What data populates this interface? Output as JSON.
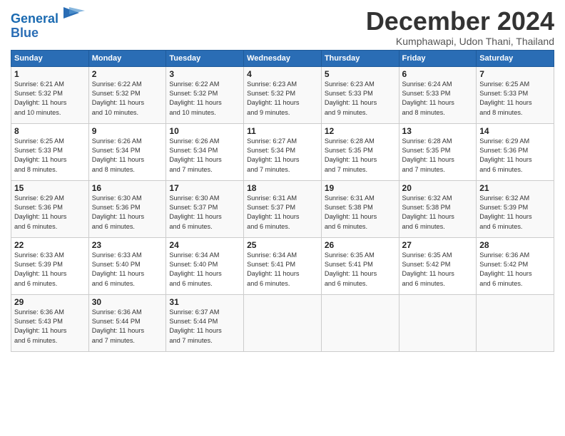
{
  "logo": {
    "line1": "General",
    "line2": "Blue"
  },
  "title": "December 2024",
  "subtitle": "Kumphawapi, Udon Thani, Thailand",
  "headers": [
    "Sunday",
    "Monday",
    "Tuesday",
    "Wednesday",
    "Thursday",
    "Friday",
    "Saturday"
  ],
  "weeks": [
    [
      {
        "day": "1",
        "info": "Sunrise: 6:21 AM\nSunset: 5:32 PM\nDaylight: 11 hours\nand 10 minutes."
      },
      {
        "day": "2",
        "info": "Sunrise: 6:22 AM\nSunset: 5:32 PM\nDaylight: 11 hours\nand 10 minutes."
      },
      {
        "day": "3",
        "info": "Sunrise: 6:22 AM\nSunset: 5:32 PM\nDaylight: 11 hours\nand 10 minutes."
      },
      {
        "day": "4",
        "info": "Sunrise: 6:23 AM\nSunset: 5:32 PM\nDaylight: 11 hours\nand 9 minutes."
      },
      {
        "day": "5",
        "info": "Sunrise: 6:23 AM\nSunset: 5:33 PM\nDaylight: 11 hours\nand 9 minutes."
      },
      {
        "day": "6",
        "info": "Sunrise: 6:24 AM\nSunset: 5:33 PM\nDaylight: 11 hours\nand 8 minutes."
      },
      {
        "day": "7",
        "info": "Sunrise: 6:25 AM\nSunset: 5:33 PM\nDaylight: 11 hours\nand 8 minutes."
      }
    ],
    [
      {
        "day": "8",
        "info": "Sunrise: 6:25 AM\nSunset: 5:33 PM\nDaylight: 11 hours\nand 8 minutes."
      },
      {
        "day": "9",
        "info": "Sunrise: 6:26 AM\nSunset: 5:34 PM\nDaylight: 11 hours\nand 8 minutes."
      },
      {
        "day": "10",
        "info": "Sunrise: 6:26 AM\nSunset: 5:34 PM\nDaylight: 11 hours\nand 7 minutes."
      },
      {
        "day": "11",
        "info": "Sunrise: 6:27 AM\nSunset: 5:34 PM\nDaylight: 11 hours\nand 7 minutes."
      },
      {
        "day": "12",
        "info": "Sunrise: 6:28 AM\nSunset: 5:35 PM\nDaylight: 11 hours\nand 7 minutes."
      },
      {
        "day": "13",
        "info": "Sunrise: 6:28 AM\nSunset: 5:35 PM\nDaylight: 11 hours\nand 7 minutes."
      },
      {
        "day": "14",
        "info": "Sunrise: 6:29 AM\nSunset: 5:36 PM\nDaylight: 11 hours\nand 6 minutes."
      }
    ],
    [
      {
        "day": "15",
        "info": "Sunrise: 6:29 AM\nSunset: 5:36 PM\nDaylight: 11 hours\nand 6 minutes."
      },
      {
        "day": "16",
        "info": "Sunrise: 6:30 AM\nSunset: 5:36 PM\nDaylight: 11 hours\nand 6 minutes."
      },
      {
        "day": "17",
        "info": "Sunrise: 6:30 AM\nSunset: 5:37 PM\nDaylight: 11 hours\nand 6 minutes."
      },
      {
        "day": "18",
        "info": "Sunrise: 6:31 AM\nSunset: 5:37 PM\nDaylight: 11 hours\nand 6 minutes."
      },
      {
        "day": "19",
        "info": "Sunrise: 6:31 AM\nSunset: 5:38 PM\nDaylight: 11 hours\nand 6 minutes."
      },
      {
        "day": "20",
        "info": "Sunrise: 6:32 AM\nSunset: 5:38 PM\nDaylight: 11 hours\nand 6 minutes."
      },
      {
        "day": "21",
        "info": "Sunrise: 6:32 AM\nSunset: 5:39 PM\nDaylight: 11 hours\nand 6 minutes."
      }
    ],
    [
      {
        "day": "22",
        "info": "Sunrise: 6:33 AM\nSunset: 5:39 PM\nDaylight: 11 hours\nand 6 minutes."
      },
      {
        "day": "23",
        "info": "Sunrise: 6:33 AM\nSunset: 5:40 PM\nDaylight: 11 hours\nand 6 minutes."
      },
      {
        "day": "24",
        "info": "Sunrise: 6:34 AM\nSunset: 5:40 PM\nDaylight: 11 hours\nand 6 minutes."
      },
      {
        "day": "25",
        "info": "Sunrise: 6:34 AM\nSunset: 5:41 PM\nDaylight: 11 hours\nand 6 minutes."
      },
      {
        "day": "26",
        "info": "Sunrise: 6:35 AM\nSunset: 5:41 PM\nDaylight: 11 hours\nand 6 minutes."
      },
      {
        "day": "27",
        "info": "Sunrise: 6:35 AM\nSunset: 5:42 PM\nDaylight: 11 hours\nand 6 minutes."
      },
      {
        "day": "28",
        "info": "Sunrise: 6:36 AM\nSunset: 5:42 PM\nDaylight: 11 hours\nand 6 minutes."
      }
    ],
    [
      {
        "day": "29",
        "info": "Sunrise: 6:36 AM\nSunset: 5:43 PM\nDaylight: 11 hours\nand 6 minutes."
      },
      {
        "day": "30",
        "info": "Sunrise: 6:36 AM\nSunset: 5:44 PM\nDaylight: 11 hours\nand 7 minutes."
      },
      {
        "day": "31",
        "info": "Sunrise: 6:37 AM\nSunset: 5:44 PM\nDaylight: 11 hours\nand 7 minutes."
      },
      {
        "day": "",
        "info": ""
      },
      {
        "day": "",
        "info": ""
      },
      {
        "day": "",
        "info": ""
      },
      {
        "day": "",
        "info": ""
      }
    ]
  ]
}
